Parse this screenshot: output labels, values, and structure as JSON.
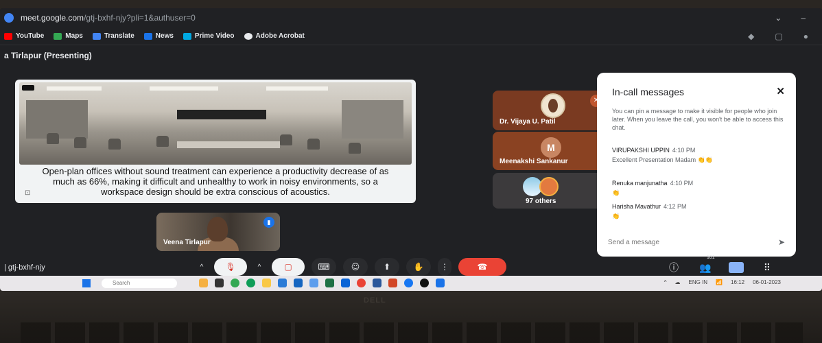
{
  "browser": {
    "url_domain": "meet.google.com",
    "url_rest": "/gtj-bxhf-njy?pli=1&authuser=0",
    "bookmarks": [
      {
        "label": "YouTube",
        "color": "#ff0000"
      },
      {
        "label": "Maps",
        "color": "#34a853"
      },
      {
        "label": "Translate",
        "color": "#4285f4"
      },
      {
        "label": "News",
        "color": "#1a73e8"
      },
      {
        "label": "Prime Video",
        "color": "#00a8e1"
      },
      {
        "label": "Adobe Acrobat",
        "color": "#e8eaed"
      }
    ]
  },
  "meet": {
    "presenting_title": "a Tirlapur (Presenting)",
    "presentation_caption": "Open-plan offices without sound treatment can experience a productivity decrease of as much as 66%, making it difficult and unhealthy to work in noisy environments, so a workspace design should be extra conscious of acoustics.",
    "self_tile_name": "Veena Tirlapur",
    "participants": [
      {
        "name": "Dr. Vijaya U. Patil"
      },
      {
        "name": "Meenakshi Sankanur",
        "initial": "M"
      }
    ],
    "others_count": "97 others",
    "meeting_code": "gtj-bxhf-njy",
    "people_count": "101",
    "colors": {
      "end_call": "#ea4335",
      "accent": "#8ab4f8",
      "tile_brown": "#7a3a21"
    }
  },
  "chat": {
    "title": "In-call messages",
    "note": "You can pin a message to make it visible for people who join later. When you leave the call, you won't be able to access this chat.",
    "messages": [
      {
        "sender": "VIRUPAKSHI UPPIN",
        "time": "4:10 PM",
        "text": "Excellent Presentation Madam"
      },
      {
        "sender": "Renuka manjunatha",
        "time": "4:10 PM",
        "text": ""
      },
      {
        "sender": "Harisha Mavathur",
        "time": "4:12 PM",
        "text": ""
      }
    ],
    "input_placeholder": "Send a message"
  },
  "taskbar": {
    "search_placeholder": "Search",
    "tray_lang": "ENG IN",
    "tray_time": "16:12",
    "tray_date": "06-01-2023"
  }
}
